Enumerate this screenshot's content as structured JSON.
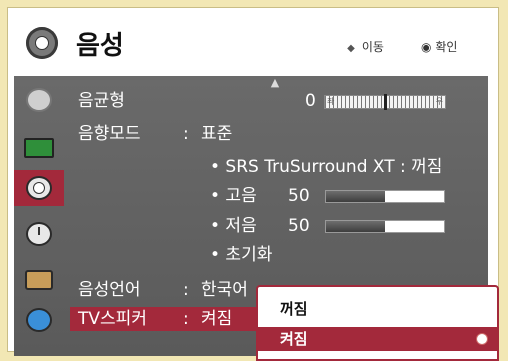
{
  "header": {
    "title": "음성",
    "hint_move": "이동",
    "hint_ok": "확인"
  },
  "rows": {
    "eq_label": "음균형",
    "eq_left": "0",
    "eq_left_mark": "좌",
    "eq_right_mark": "우",
    "mode_label": "음향모드",
    "mode_sep": ":",
    "mode_value": "표준",
    "srs": "• SRS TruSurround XT : 꺼짐",
    "treble_label": "• 고음",
    "treble_value": "50",
    "bass_label": "• 저음",
    "bass_value": "50",
    "reset": "• 초기화",
    "lang_label": "음성언어",
    "lang_sep": ":",
    "lang_value": "한국어",
    "spk_label": "TV스피커",
    "spk_sep": ":",
    "spk_value": "켜짐"
  },
  "levels": {
    "treble": 0.5,
    "bass": 0.5,
    "balance": 0
  },
  "popup": {
    "off": "꺼짐",
    "on": "켜짐"
  },
  "colors": {
    "accent": "#a3293b",
    "background": "#f2e7b4",
    "panel": "#626262"
  }
}
